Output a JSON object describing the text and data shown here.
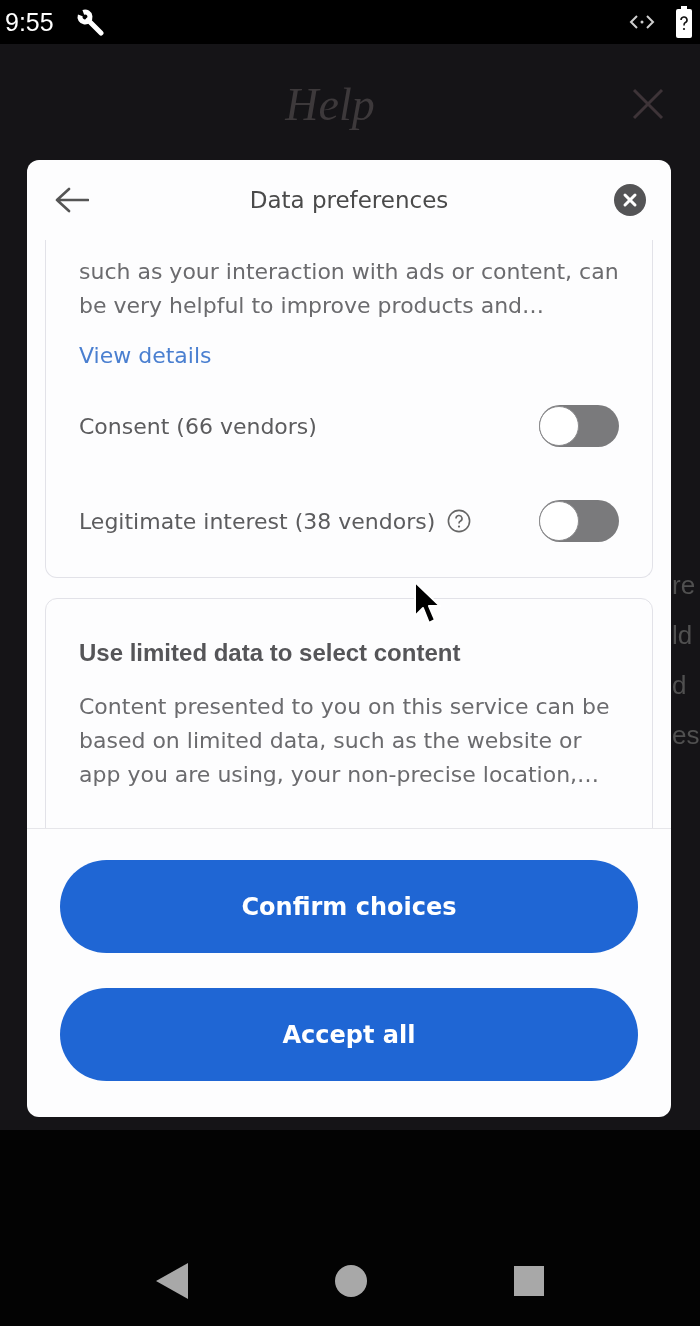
{
  "status_bar": {
    "time": "9:55"
  },
  "background": {
    "title": "Help",
    "edge_text": [
      "re",
      "ld",
      "d",
      "es"
    ]
  },
  "dialog": {
    "title": "Data preferences",
    "sections": [
      {
        "description": "such as your interaction with ads or content, can be very helpful to improve products and…",
        "link": "View details",
        "toggles": [
          {
            "label": "Consent (66 vendors)",
            "on": false,
            "help": false
          },
          {
            "label": "Legitimate interest (38 vendors)",
            "on": false,
            "help": true
          }
        ]
      },
      {
        "heading": "Use limited data to select content",
        "description": "Content presented to you on this service can be based on limited data, such as the website or app you are using, your non-precise location,…"
      }
    ],
    "buttons": [
      "Confirm choices",
      "Accept all"
    ]
  }
}
